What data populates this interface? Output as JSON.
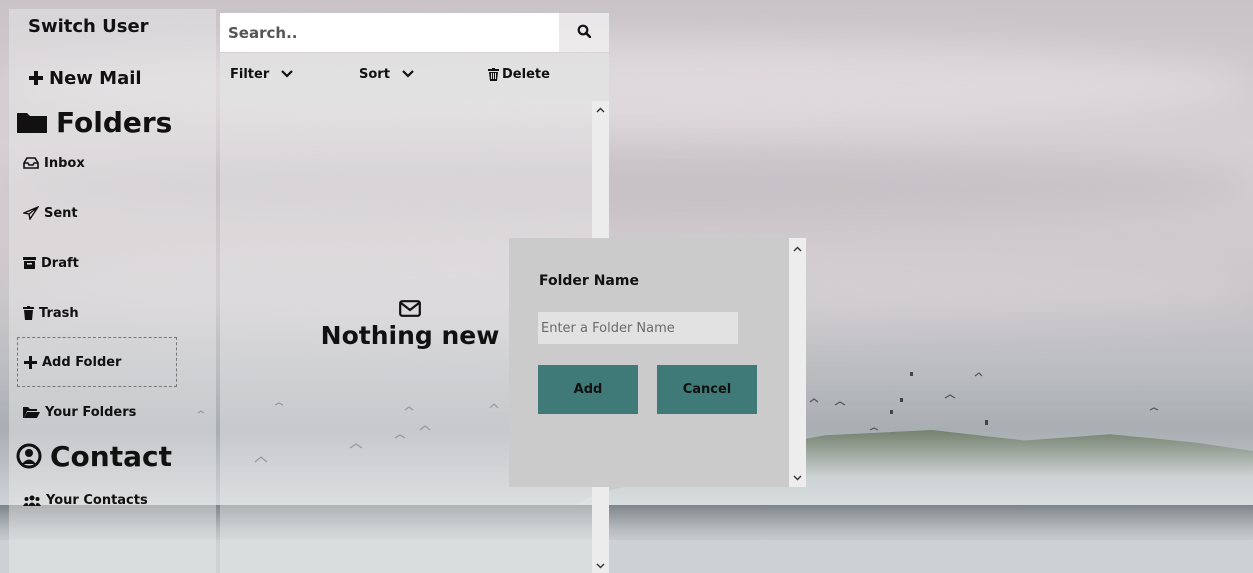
{
  "sidebar": {
    "switch_user": "Switch User",
    "new_mail": "New Mail",
    "folders_heading": "Folders",
    "items": [
      {
        "label": "Inbox",
        "icon": "inbox-icon"
      },
      {
        "label": "Sent",
        "icon": "paper-plane-icon"
      },
      {
        "label": "Draft",
        "icon": "archive-icon"
      },
      {
        "label": "Trash",
        "icon": "trash-icon"
      },
      {
        "label": "Add Folder",
        "icon": "plus-icon"
      },
      {
        "label": "Your Folders",
        "icon": "folder-open-icon"
      }
    ],
    "contact_heading": "Contact",
    "your_contacts": "Your Contacts"
  },
  "search": {
    "placeholder": "Search.."
  },
  "toolbar": {
    "filter": "Filter",
    "sort": "Sort",
    "delete": "Delete"
  },
  "mail_list": {
    "empty_text": "Nothing new"
  },
  "folder_dialog": {
    "label": "Folder Name",
    "input_placeholder": "Enter a Folder Name",
    "add_button": "Add",
    "cancel_button": "Cancel"
  },
  "colors": {
    "accent": "#3f7a78",
    "dialog_bg": "#cbcbcb"
  }
}
